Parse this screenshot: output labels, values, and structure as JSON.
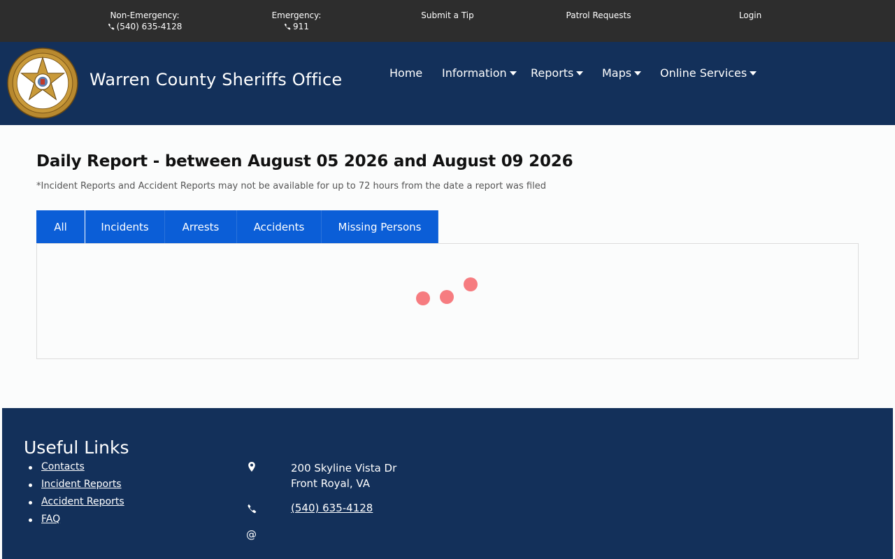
{
  "topbar": {
    "non_emergency_label": "Non-Emergency:",
    "non_emergency_phone": "(540) 635-4128",
    "emergency_label": "Emergency:",
    "emergency_phone": "911",
    "submit_tip": "Submit a Tip",
    "patrol_requests": "Patrol Requests",
    "login": "Login"
  },
  "header": {
    "brand": "Warren County Sheriffs Office",
    "nav": {
      "home": "Home",
      "information": "Information",
      "reports": "Reports",
      "maps": "Maps",
      "online_services": "Online Services"
    }
  },
  "main": {
    "title": "Daily Report - between August 05 2026 and August 09 2026",
    "note": "*Incident Reports and Accident Reports may not be available for up to 72 hours from the date a report was filed",
    "tabs": [
      "All",
      "Incidents",
      "Arrests",
      "Accidents",
      "Missing Persons"
    ],
    "active_tab": "All"
  },
  "footer": {
    "useful_links_title": "Useful Links",
    "links": [
      "Contacts",
      "Incident Reports",
      "Accident Reports",
      "FAQ"
    ],
    "address_line1": "200 Skyline Vista Dr",
    "address_line2": "Front Royal, VA",
    "phone": "(540) 635-4128",
    "email_symbol": "@"
  },
  "icons": {
    "phone": "phone-icon",
    "location": "map-marker-icon",
    "email": "at-sign-icon",
    "dropdown": "caret-down-icon"
  },
  "colors": {
    "topbar": "#2d2d2d",
    "header": "#13305a",
    "tab": "#0b5ed7",
    "loader": "#f67c80"
  }
}
